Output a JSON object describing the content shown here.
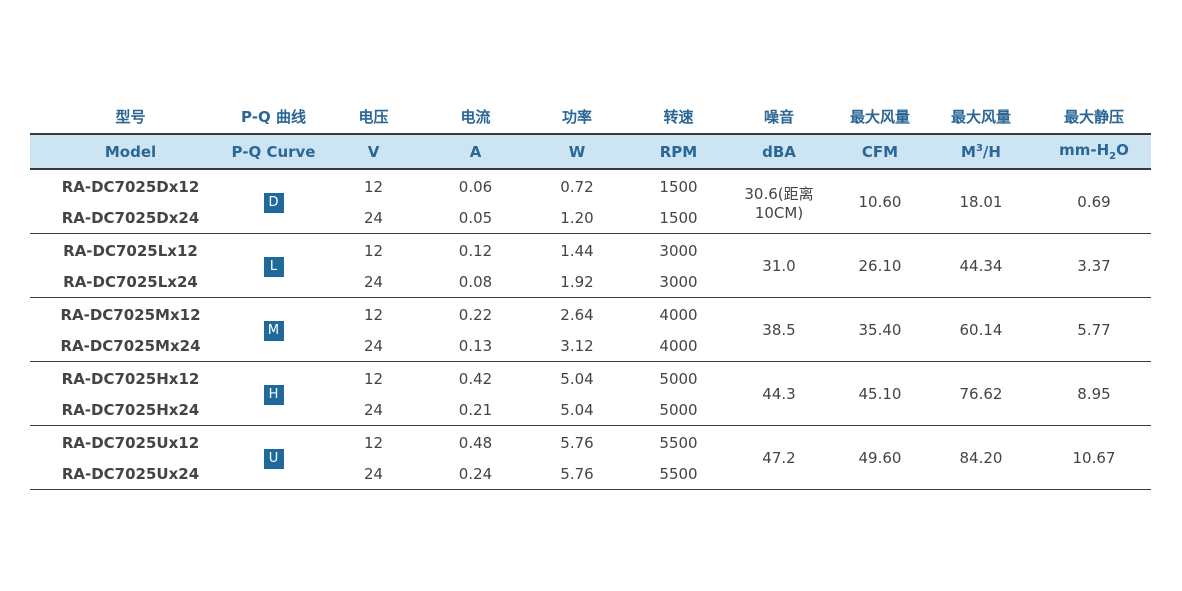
{
  "header_cn": [
    "型号",
    "P-Q 曲线",
    "电压",
    "电流",
    "功率",
    "转速",
    "噪音",
    "最大风量",
    "最大风量",
    "最大静压"
  ],
  "header_en": {
    "model": "Model",
    "pq": "P-Q Curve",
    "v": "V",
    "a": "A",
    "w": "W",
    "rpm": "RPM",
    "dba": "dBA",
    "cfm": "CFM",
    "m3h_base": "M",
    "m3h_sup": "3",
    "m3h_tail": "/H",
    "mmh2o_base": "mm-H",
    "mmh2o_sub": "2",
    "mmh2o_tail": "O"
  },
  "groups": [
    {
      "curve": "D",
      "dba": "30.6(距离10CM)",
      "cfm": "10.60",
      "m3h": "18.01",
      "mmh2o": "0.69",
      "rows": [
        {
          "model": "RA-DC7025Dx12",
          "v": "12",
          "a": "0.06",
          "w": "0.72",
          "rpm": "1500"
        },
        {
          "model": "RA-DC7025Dx24",
          "v": "24",
          "a": "0.05",
          "w": "1.20",
          "rpm": "1500"
        }
      ]
    },
    {
      "curve": "L",
      "dba": "31.0",
      "cfm": "26.10",
      "m3h": "44.34",
      "mmh2o": "3.37",
      "rows": [
        {
          "model": "RA-DC7025Lx12",
          "v": "12",
          "a": "0.12",
          "w": "1.44",
          "rpm": "3000"
        },
        {
          "model": "RA-DC7025Lx24",
          "v": "24",
          "a": "0.08",
          "w": "1.92",
          "rpm": "3000"
        }
      ]
    },
    {
      "curve": "M",
      "dba": "38.5",
      "cfm": "35.40",
      "m3h": "60.14",
      "mmh2o": "5.77",
      "rows": [
        {
          "model": "RA-DC7025Mx12",
          "v": "12",
          "a": "0.22",
          "w": "2.64",
          "rpm": "4000"
        },
        {
          "model": "RA-DC7025Mx24",
          "v": "24",
          "a": "0.13",
          "w": "3.12",
          "rpm": "4000"
        }
      ]
    },
    {
      "curve": "H",
      "dba": "44.3",
      "cfm": "45.10",
      "m3h": "76.62",
      "mmh2o": "8.95",
      "rows": [
        {
          "model": "RA-DC7025Hx12",
          "v": "12",
          "a": "0.42",
          "w": "5.04",
          "rpm": "5000"
        },
        {
          "model": "RA-DC7025Hx24",
          "v": "24",
          "a": "0.21",
          "w": "5.04",
          "rpm": "5000"
        }
      ]
    },
    {
      "curve": "U",
      "dba": "47.2",
      "cfm": "49.60",
      "m3h": "84.20",
      "mmh2o": "10.67",
      "rows": [
        {
          "model": "RA-DC7025Ux12",
          "v": "12",
          "a": "0.48",
          "w": "5.76",
          "rpm": "5500"
        },
        {
          "model": "RA-DC7025Ux24",
          "v": "24",
          "a": "0.24",
          "w": "5.76",
          "rpm": "5500"
        }
      ]
    }
  ],
  "colors": {
    "header_text": "#2a6796",
    "header_bg": "#cde4f3",
    "badge_bg": "#1f6a9a",
    "rule": "#3a3a3a"
  }
}
